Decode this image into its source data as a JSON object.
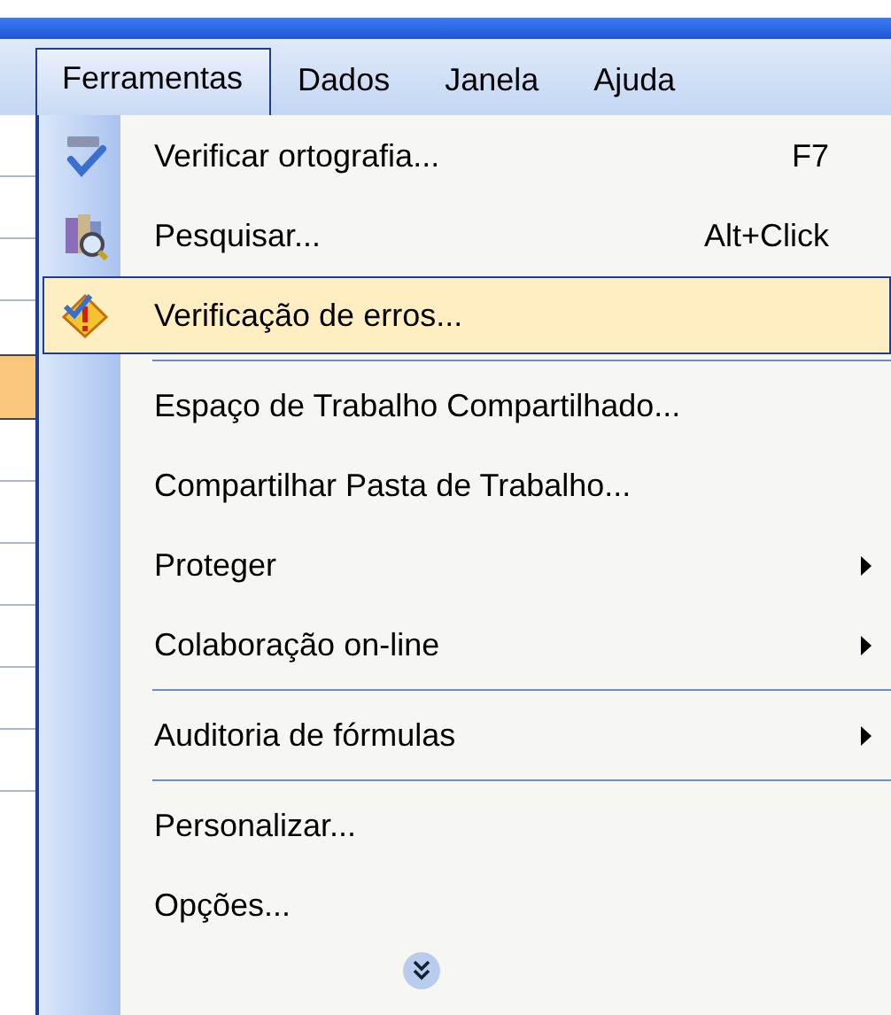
{
  "menu_bar": [
    {
      "label": "Ferramentas",
      "selected": true
    },
    {
      "label": "Dados",
      "selected": false
    },
    {
      "label": "Janela",
      "selected": false
    },
    {
      "label": "Ajuda",
      "selected": false
    }
  ],
  "menu": {
    "items": [
      {
        "kind": "command",
        "label": "Verificar ortografia...",
        "shortcut": "F7",
        "selected": false
      },
      {
        "kind": "command",
        "label": "Pesquisar...",
        "shortcut": "Alt+Click",
        "selected": false
      },
      {
        "kind": "command",
        "label": "Verificação de erros...",
        "selected": true
      },
      {
        "kind": "separator"
      },
      {
        "kind": "command",
        "label": "Espaço de Trabalho Compartilhado...",
        "selected": false
      },
      {
        "kind": "command",
        "label": "Compartilhar Pasta de Trabalho...",
        "selected": false
      },
      {
        "kind": "submenu",
        "label": "Proteger",
        "selected": false
      },
      {
        "kind": "submenu",
        "label": "Colaboração on-line",
        "selected": false
      },
      {
        "kind": "separator"
      },
      {
        "kind": "submenu",
        "label": "Auditoria de fórmulas",
        "selected": false
      },
      {
        "kind": "separator"
      },
      {
        "kind": "command",
        "label": "Personalizar...",
        "selected": false
      },
      {
        "kind": "command",
        "label": "Opções...",
        "selected": false
      },
      {
        "kind": "expand"
      }
    ]
  }
}
